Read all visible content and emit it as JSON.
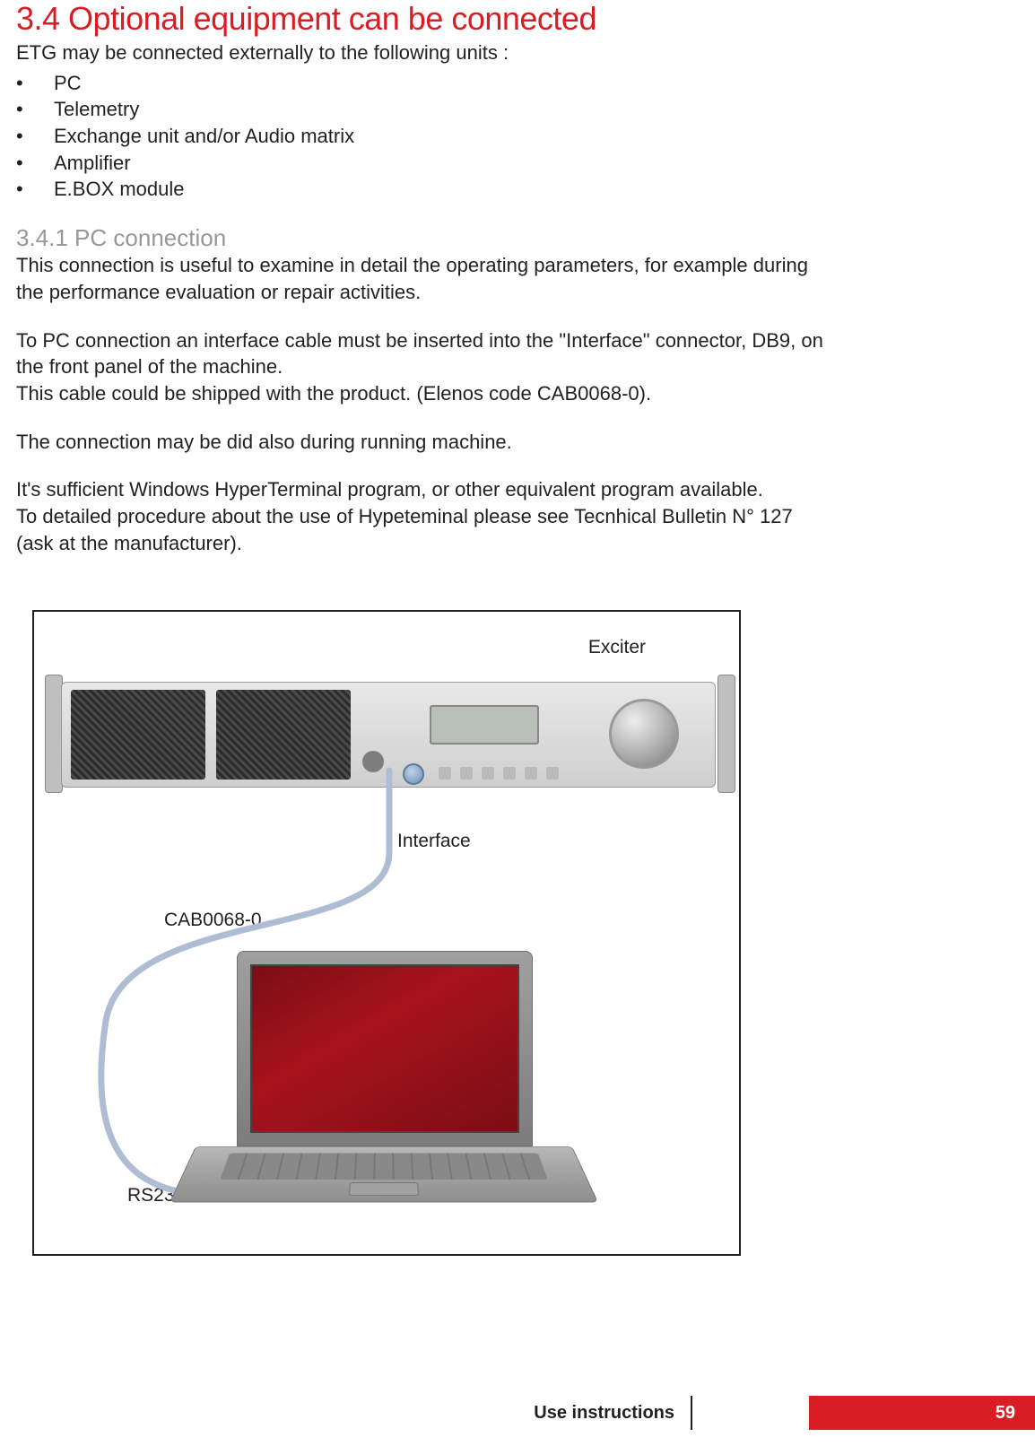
{
  "section": {
    "number": "3.4",
    "title": "3.4 Optional equipment can be connected",
    "intro": "ETG may be connected externally to the following units :",
    "bullets": [
      "PC",
      "Telemetry",
      "Exchange unit and/or Audio matrix",
      "Amplifier",
      "E.BOX module"
    ]
  },
  "subsection": {
    "title": "3.4.1 PC connection",
    "p1": "This connection is useful to examine in detail the operating parameters, for example during the performance evaluation or repair activities.",
    "p2": "To PC connection an interface cable must be inserted into the \"Interface\" connector, DB9, on the front panel of the machine.",
    "p3": "This cable could be shipped with the product. (Elenos code CAB0068-0).",
    "p4": "The connection may be did also during running machine.",
    "p5": "It's sufficient Windows HyperTerminal program,  or other equivalent program available.",
    "p6": "To detailed procedure about the use of Hypeteminal please see Tecnhical Bulletin N° 127 (ask at the manufacturer)."
  },
  "figure": {
    "labels": {
      "exciter": "Exciter",
      "interface": "Interface",
      "cable": "CAB0068-0",
      "port": "RS232"
    }
  },
  "footer": {
    "label": "Use instructions",
    "page": "59"
  }
}
